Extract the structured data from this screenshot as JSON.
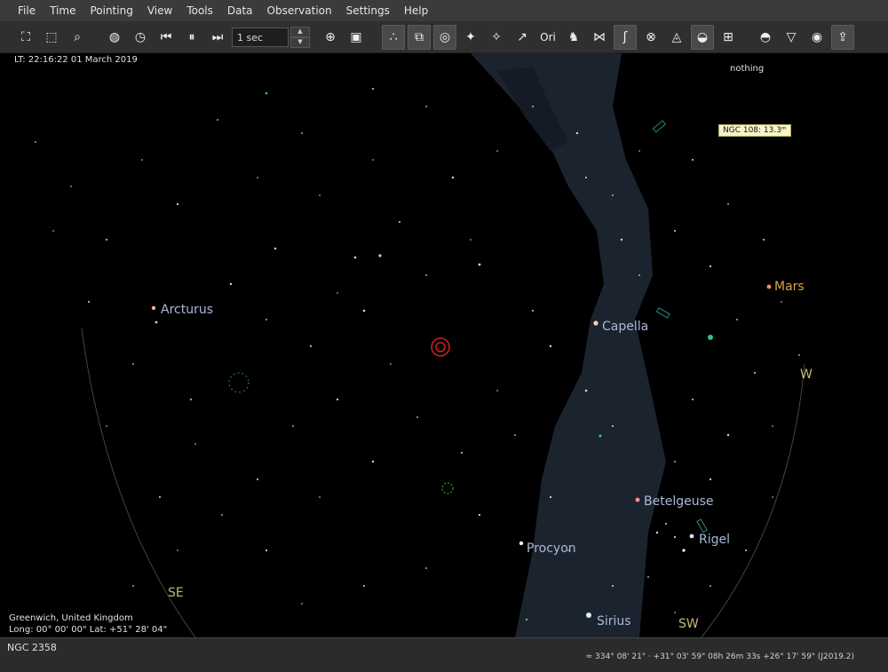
{
  "menubar": {
    "items": [
      "File",
      "Time",
      "Pointing",
      "View",
      "Tools",
      "Data",
      "Observation",
      "Settings",
      "Help"
    ]
  },
  "toolbar": {
    "time_step": "1 sec",
    "ori_label": "Ori"
  },
  "overlay": {
    "local_time": "LT: 22:16:22   01 March 2019",
    "location_line1": "Greenwich, United Kingdom",
    "location_line2": "Long:  00° 00' 00\"   Lat: +51° 28' 04\"",
    "focus_object": "nothing",
    "hover_tooltip": "NGC 108: 13.3ᵐ"
  },
  "sky_labels": {
    "stars": [
      "Arcturus",
      "Capella",
      "Betelgeuse",
      "Rigel",
      "Procyon",
      "Sirius"
    ],
    "planets": [
      "Mars"
    ],
    "directions": [
      "W",
      "SE",
      "SW"
    ]
  },
  "colors": {
    "star_label": "#a9b9d8",
    "planet_label": "#e0a040",
    "direction_label": "#c8b87a",
    "milky_way": "#1c2530",
    "horizon": "#3a4a3a",
    "selection_marker": "#d22020"
  },
  "statusbar": {
    "object": "NGC 2358",
    "coordinates": "≈ 334° 08' 21\"  ·  +31° 03' 59\"   08h 26m 33s   +26° 17' 59\" (J2019.2)"
  }
}
